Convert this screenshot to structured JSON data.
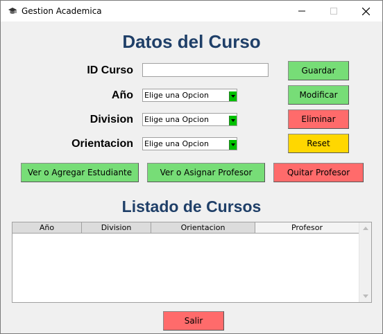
{
  "window": {
    "title": "Gestion Academica"
  },
  "form": {
    "heading": "Datos del Curso",
    "id_label": "ID Curso",
    "id_value": "",
    "anio_label": "Año",
    "anio_value": "Elige una Opcion",
    "division_label": "Division",
    "division_value": "Elige una Opcion",
    "orientacion_label": "Orientacion",
    "orientacion_value": "Elige una Opcion"
  },
  "buttons": {
    "guardar": "Guardar",
    "modificar": "Modificar",
    "eliminar": "Eliminar",
    "reset": "Reset",
    "ver_estudiante": "Ver o Agregar Estudiante",
    "ver_profesor": "Ver o Asignar Profesor",
    "quitar_profesor": "Quitar Profesor",
    "salir": "Salir"
  },
  "list": {
    "heading": "Listado de Cursos",
    "columns": [
      "Año",
      "Division",
      "Orientacion",
      "Profesor"
    ],
    "rows": []
  },
  "colors": {
    "heading": "#1f3f68",
    "green": "#77dd77",
    "red": "#ff6b6b",
    "yellow": "#ffd700"
  }
}
